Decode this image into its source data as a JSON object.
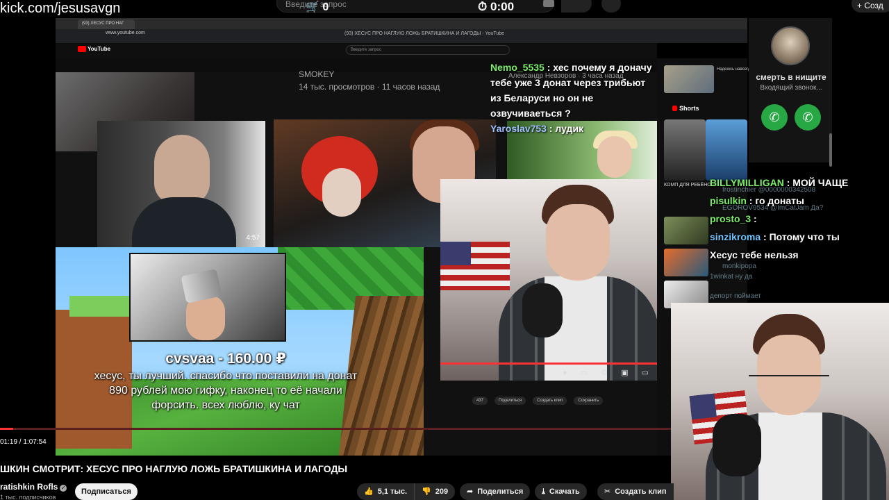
{
  "overlay": {
    "kick_url": "kick.com/jesusavgn",
    "top_search_placeholder": "Введите запрос",
    "counter": "0",
    "timer": "0:00",
    "create_label": "Созд"
  },
  "browser": {
    "tab_title": "(93) ХЕСУС ПРО НАГ",
    "url": "www.youtube.com",
    "window_title": "(93) ХЕСУС ПРО НАГЛУЮ ЛОЖЬ БРАТИШКИНА И ЛАГОДЫ - YouTube",
    "yt_logo": "YouTube",
    "search_placeholder": "Введите запрос"
  },
  "video_content": {
    "channel_smokey": "SMOKEY",
    "views": "14 тыс. просмотров · 11 часов назад",
    "tile_duration": "4:57",
    "nevzorov": "Александр Невзоров · 3 часа назад",
    "inner_chat": [
      {
        "user": "Nemo_5535",
        "text": " : хес почему я доначу тебе уже 3 донат через трибьют из Беларуси но он не озвучиваеться ?",
        "cls": "u"
      },
      {
        "user": "Yaroslav753",
        "text": " : лудик",
        "cls": "u2"
      }
    ],
    "donation_title": "cvsvaa - 160.00 ₽",
    "donation_message": "хесус, ты лучший. спасибо что поставили на донат 890 рублей мою гифку, наконец то её начали форсить. всех люблю, ку чат",
    "inner_actions": [
      "437",
      "Поделиться",
      "Создать клип",
      "Сохранить"
    ],
    "shorts_label": "Shorts",
    "short_caption": "КОМП ДЛЯ РЕБЁНОЧК...",
    "sidebar_title": "Надеюсь навсегда НЕВИНОВНЫХ"
  },
  "call": {
    "name": "смерть в нищите",
    "status": "Входящий звонок..."
  },
  "chat": [
    {
      "user": "BILLYMILLIGAN",
      "text": " : МОЙ ЧАЩЕ",
      "cls": "u"
    },
    {
      "user": "pisulkin",
      "text": " : го донаты",
      "cls": "u"
    },
    {
      "user": "prosto_3",
      "text": " :",
      "cls": "u"
    },
    {
      "user": "sinzikroma",
      "text": " : Потому что ты",
      "cls": "u2"
    },
    {
      "user": "",
      "text": "Хесус тебе нельзя",
      "cls": "u"
    }
  ],
  "chat_faded": [
    "frostinchier @0000000342508",
    "EGOROV9534 @ImCatJam Да?",
    "monkipopa",
    "1winkat ну да",
    "депорт поймает"
  ],
  "player": {
    "time": "01:19 / 1:07:54",
    "progress": 0.0193
  },
  "meta": {
    "title": "ШКИН СМОТРИТ: ХЕСУС ПРО НАГЛУЮ ЛОЖЬ БРАТИШКИНА И ЛАГОДЫ",
    "channel": "ratishkin Rofls",
    "subscribers": "1 тыс. подписчиков",
    "subscribe": "Подписаться",
    "likes": "5,1 тыс.",
    "dislikes": "209",
    "share": "Поделиться",
    "download": "Скачать",
    "clip": "Создать клип"
  }
}
